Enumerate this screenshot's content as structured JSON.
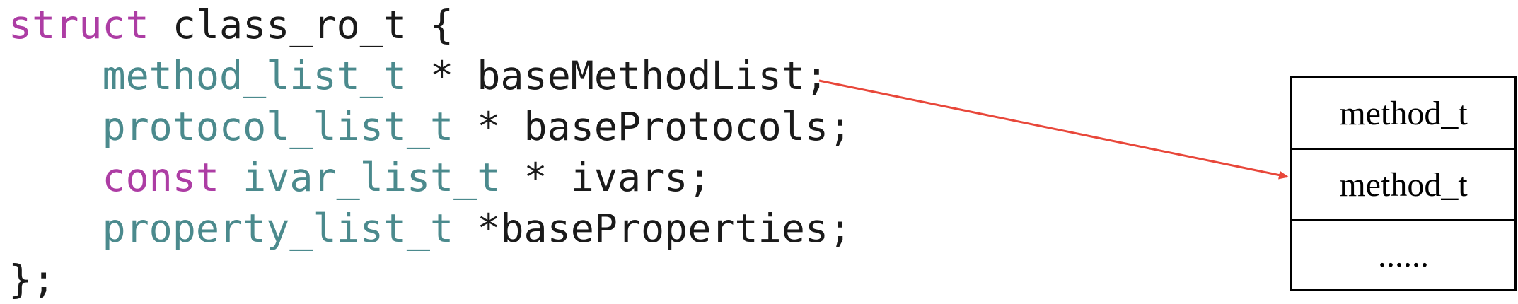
{
  "code": {
    "line1": {
      "keyword": "struct",
      "rest": " class_ro_t {"
    },
    "line2": {
      "type": "method_list_t",
      "rest": " * baseMethodList;"
    },
    "line3": {
      "type": "protocol_list_t",
      "rest": " * baseProtocols;"
    },
    "line4": {
      "keyword": "const",
      "type": "ivar_list_t",
      "rest": " * ivars;"
    },
    "line5": {
      "type": "property_list_t",
      "rest": " *baseProperties;"
    },
    "line6": {
      "rest": "};"
    }
  },
  "list": {
    "cells": [
      "method_t",
      "method_t",
      "......"
    ]
  },
  "colors": {
    "keyword": "#ad3da4",
    "type": "#4b8a8d",
    "text": "#1a1a1a",
    "arrow": "#e8473a"
  }
}
